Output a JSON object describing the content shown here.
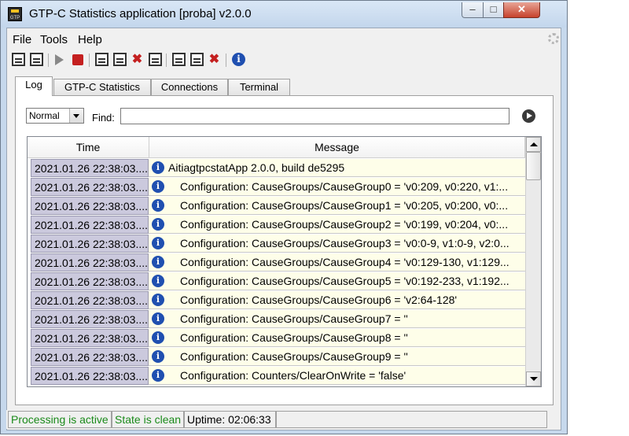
{
  "window": {
    "title": "GTP-C Statistics application [proba] v2.0.0",
    "app_icon_text": "GTP",
    "controls": {
      "minimize": "–",
      "maximize": "□",
      "close": "✕"
    }
  },
  "menu": {
    "file": "File",
    "tools": "Tools",
    "help": "Help"
  },
  "toolbar": {
    "icons": [
      "config-load-icon",
      "config-save-icon",
      "start-icon",
      "stop-icon",
      "save-log-icon",
      "save-all-icon",
      "clear-icon",
      "print-icon",
      "export-icon",
      "check-icon",
      "delete-icon",
      "about-icon"
    ],
    "x_glyph": "✖",
    "info_glyph": "i"
  },
  "tabs": [
    {
      "label": "Log",
      "active": true
    },
    {
      "label": "GTP-C Statistics",
      "active": false
    },
    {
      "label": "Connections",
      "active": false
    },
    {
      "label": "Terminal",
      "active": false
    }
  ],
  "filter": {
    "level_selected": "Normal",
    "find_label": "Find:",
    "find_value": ""
  },
  "log_table": {
    "columns": [
      "Time",
      "Message"
    ],
    "row_icon_glyph": "i",
    "rows": [
      {
        "time": "2021.01.26 22:38:03....",
        "message": "AitiagtpcstatApp 2.0.0, build de5295",
        "indent": false
      },
      {
        "time": "2021.01.26 22:38:03....",
        "message": "Configuration: CauseGroups/CauseGroup0 = 'v0:209, v0:220, v1:...",
        "indent": true
      },
      {
        "time": "2021.01.26 22:38:03....",
        "message": "Configuration: CauseGroups/CauseGroup1 = 'v0:205, v0:200, v0:...",
        "indent": true
      },
      {
        "time": "2021.01.26 22:38:03....",
        "message": "Configuration: CauseGroups/CauseGroup2 = 'v0:199, v0:204, v0:...",
        "indent": true
      },
      {
        "time": "2021.01.26 22:38:03....",
        "message": "Configuration: CauseGroups/CauseGroup3 = 'v0:0-9, v1:0-9, v2:0...",
        "indent": true
      },
      {
        "time": "2021.01.26 22:38:03....",
        "message": "Configuration: CauseGroups/CauseGroup4 = 'v0:129-130, v1:129...",
        "indent": true
      },
      {
        "time": "2021.01.26 22:38:03....",
        "message": "Configuration: CauseGroups/CauseGroup5 = 'v0:192-233, v1:192...",
        "indent": true
      },
      {
        "time": "2021.01.26 22:38:03....",
        "message": "Configuration: CauseGroups/CauseGroup6 = 'v2:64-128'",
        "indent": true
      },
      {
        "time": "2021.01.26 22:38:03....",
        "message": "Configuration: CauseGroups/CauseGroup7 = ''",
        "indent": true
      },
      {
        "time": "2021.01.26 22:38:03....",
        "message": "Configuration: CauseGroups/CauseGroup8 = ''",
        "indent": true
      },
      {
        "time": "2021.01.26 22:38:03....",
        "message": "Configuration: CauseGroups/CauseGroup9 = ''",
        "indent": true
      },
      {
        "time": "2021.01.26 22:38:03....",
        "message": "Configuration: Counters/ClearOnWrite = 'false'",
        "indent": true
      }
    ]
  },
  "status": {
    "processing": "Processing is active",
    "state": "State is clean",
    "uptime": "Uptime: 02:06:33",
    "accent_color": "#1a8a1a"
  }
}
